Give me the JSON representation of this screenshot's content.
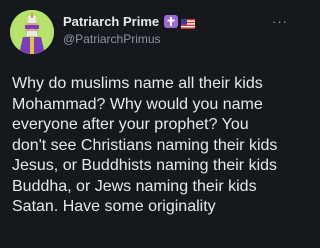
{
  "author": {
    "display_name": "Patriarch Prime",
    "handle": "@PatriarchPrimus",
    "avatar_icon": "robed-figure-avatar",
    "badges": [
      "cross-emoji-icon",
      "us-flag-emoji-icon"
    ]
  },
  "more_icon_glyph": "···",
  "tweet": {
    "text": "Why do muslims name all their kids\nMohammad? Why would you name\neveryone after your prophet? You\ndon't see Christians naming their kids\nJesus, or Buddhists naming their kids\nBuddha, or Jews naming their kids\nSatan. Have some originality"
  },
  "colors": {
    "background": "#15181c",
    "text": "#e7e9ea",
    "muted": "#8b98a5",
    "avatar_bg": "#b7e26b",
    "cross_badge": "#9b6bd6"
  }
}
